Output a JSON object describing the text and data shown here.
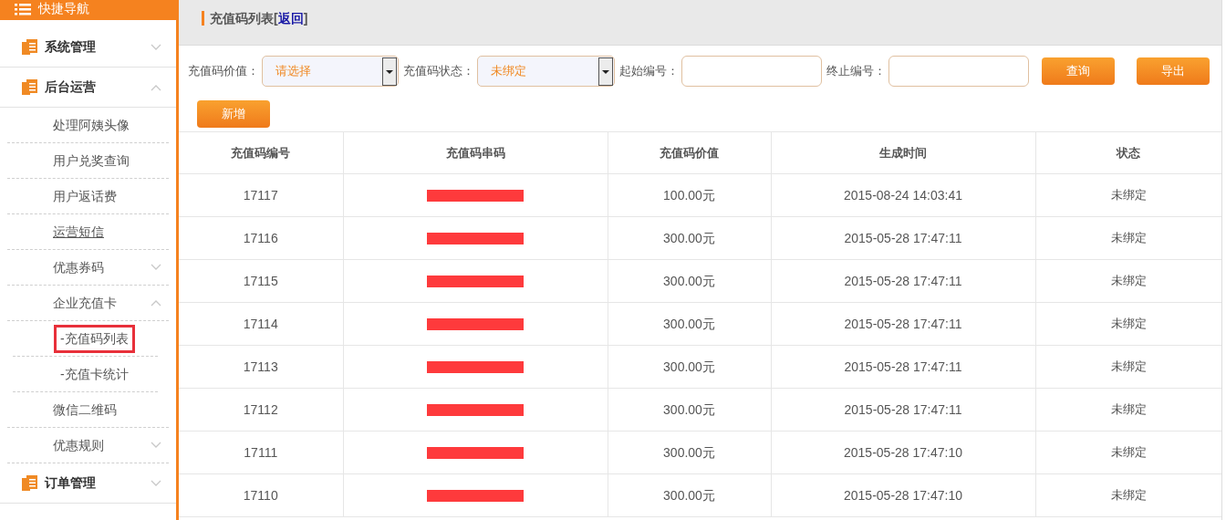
{
  "sidebar": {
    "header": "快捷导航",
    "sections": [
      {
        "label": "系统管理",
        "expanded": false
      },
      {
        "label": "后台运营",
        "expanded": true,
        "children": [
          {
            "label": "处理阿姨头像",
            "kind": "link",
            "underlined": false
          },
          {
            "label": "用户兑奖查询",
            "kind": "link",
            "underlined": false
          },
          {
            "label": "用户返话费",
            "kind": "link",
            "underlined": false
          },
          {
            "label": "运营短信",
            "kind": "link",
            "underlined": true
          },
          {
            "label": "优惠券码",
            "kind": "group",
            "expanded": false
          },
          {
            "label": "企业充值卡",
            "kind": "group",
            "expanded": true,
            "children": [
              {
                "label": "-充值码列表",
                "highlighted": true
              },
              {
                "label": "-充值卡统计",
                "highlighted": false
              }
            ]
          },
          {
            "label": "微信二维码",
            "kind": "link",
            "underlined": false
          },
          {
            "label": "优惠规则",
            "kind": "group",
            "expanded": false
          }
        ]
      },
      {
        "label": "订单管理",
        "expanded": false
      }
    ]
  },
  "page": {
    "title": "充值码列表",
    "bracket_open": "[",
    "back_link": "返回",
    "bracket_close": "]"
  },
  "filters": {
    "value_label": "充值码价值：",
    "value_select": "请选择",
    "status_label": "充值码状态：",
    "status_select": "未绑定",
    "start_label": "起始编号：",
    "end_label": "终止编号：",
    "buttons": [
      "查询",
      "导出"
    ],
    "add_button": "新增"
  },
  "table": {
    "columns": [
      "充值码编号",
      "充值码串码",
      "充值码价值",
      "生成时间",
      "状态"
    ],
    "rows": [
      {
        "id": "17117",
        "serial_redacted": true,
        "value": "100.00元",
        "time": "2015-08-24 14:03:41",
        "status": "未绑定"
      },
      {
        "id": "17116",
        "serial_redacted": true,
        "value": "300.00元",
        "time": "2015-05-28 17:47:11",
        "status": "未绑定"
      },
      {
        "id": "17115",
        "serial_redacted": true,
        "value": "300.00元",
        "time": "2015-05-28 17:47:11",
        "status": "未绑定"
      },
      {
        "id": "17114",
        "serial_redacted": true,
        "value": "300.00元",
        "time": "2015-05-28 17:47:11",
        "status": "未绑定"
      },
      {
        "id": "17113",
        "serial_redacted": true,
        "value": "300.00元",
        "time": "2015-05-28 17:47:11",
        "status": "未绑定"
      },
      {
        "id": "17112",
        "serial_redacted": true,
        "value": "300.00元",
        "time": "2015-05-28 17:47:11",
        "status": "未绑定"
      },
      {
        "id": "17111",
        "serial_redacted": true,
        "value": "300.00元",
        "time": "2015-05-28 17:47:10",
        "status": "未绑定"
      },
      {
        "id": "17110",
        "serial_redacted": true,
        "value": "300.00元",
        "time": "2015-05-28 17:47:10",
        "status": "未绑定"
      }
    ]
  }
}
